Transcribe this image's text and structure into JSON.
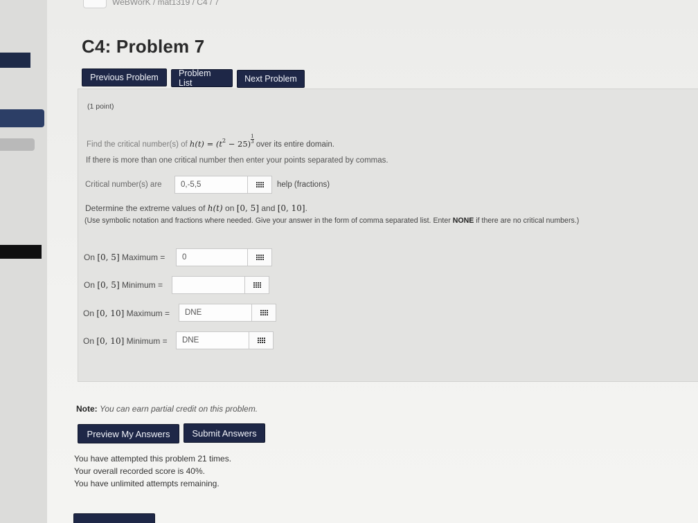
{
  "breadcrumb": "WeBWorK / mat1319 / C4 / 7",
  "page_title": "C4: Problem 7",
  "nav": {
    "prev_label": "Previous Problem",
    "list_label": "Problem List",
    "next_label": "Next Problem"
  },
  "problem": {
    "points": "(1 point)",
    "q1_prefix": "Find the critical number(s) of",
    "q1_func_lhs": "h(t)",
    "q1_equals": " = ",
    "q1_base": "(t",
    "q1_exp": "2",
    "q1_minus": " − 25)",
    "q1_frac_num": "1",
    "q1_frac_den": "3",
    "q1_suffix": "over its entire domain.",
    "q1_instructions": "If there is more than one critical number then enter your points separated by commas.",
    "critical_label": "Critical number(s) are",
    "critical_value": "0,-5,5",
    "help_link": "help (fractions)",
    "q2_prefix": "Determine the extreme values of",
    "q2_func": "h(t)",
    "q2_on": "on",
    "q2_int1": "[0, 5]",
    "q2_and": "and",
    "q2_int2": "[0, 10]",
    "q2_period": ".",
    "q2_note_pre": "(Use symbolic notation and fractions where needed. Give your answer in the form of comma separated list. Enter",
    "q2_note_bold": "NONE",
    "q2_note_post": "if there are no critical numbers.)",
    "answers": [
      {
        "on": "On",
        "interval": "[0, 5]",
        "kind": "Maximum =",
        "value": "0"
      },
      {
        "on": "On",
        "interval": "[0, 5]",
        "kind": "Minimum =",
        "value": ""
      },
      {
        "on": "On",
        "interval": "[0, 10]",
        "kind": "Maximum =",
        "value": "DNE"
      },
      {
        "on": "On",
        "interval": "[0, 10]",
        "kind": "Minimum =",
        "value": "DNE"
      }
    ]
  },
  "note": {
    "label": "Note:",
    "text": "You can earn partial credit on this problem."
  },
  "actions": {
    "preview_label": "Preview My Answers",
    "submit_label": "Submit Answers"
  },
  "status": {
    "attempts": "You have attempted this problem 21 times.",
    "score": "Your overall recorded score is 40%.",
    "remaining": "You have unlimited attempts remaining."
  },
  "colors": {
    "button_bg": "#1e2747",
    "button_text": "#f2f4fa"
  },
  "icons": [
    "grid-icon"
  ]
}
